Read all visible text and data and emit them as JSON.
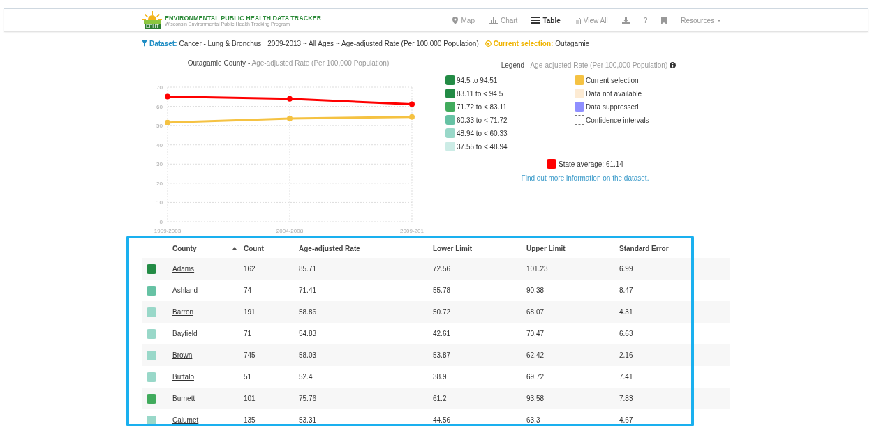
{
  "header": {
    "logo_badge": "EPHT",
    "title": "ENVIRONMENTAL PUBLIC HEALTH DATA TRACKER",
    "subtitle": "Wisconsin Environmental Public Health Tracking Program"
  },
  "nav": [
    {
      "kind": "map",
      "label": "Map",
      "selected": false
    },
    {
      "kind": "chart",
      "label": "Chart",
      "selected": false
    },
    {
      "kind": "table",
      "label": "Table",
      "selected": true
    },
    {
      "kind": "viewall",
      "label": "View All",
      "selected": false
    },
    {
      "kind": "download"
    },
    {
      "kind": "help",
      "label": "?"
    },
    {
      "kind": "bookmark"
    },
    {
      "kind": "menu",
      "label": "Resources"
    }
  ],
  "dataset_bar": {
    "label": "Dataset:",
    "dataset": "Cancer - Lung & Bronchus",
    "details": "2009-2013 ~ All Ages ~ Age-adjusted Rate (Per 100,000 Population)",
    "selection_label": "Current selection:",
    "selection": "Outagamie"
  },
  "chart": {
    "heading": "Outagamie County -",
    "subheading": "Age-adjusted Rate (Per 100,000 Population)",
    "chart_data": {
      "type": "line",
      "grid": true,
      "categories": [
        "1999-2003",
        "2004-2008",
        "2009-201"
      ],
      "ylim": [
        0,
        70
      ],
      "yticks": [
        0,
        10,
        20,
        30,
        40,
        50,
        60,
        70
      ],
      "series": [
        {
          "color": "#ff0000",
          "marker": true,
          "values": [
            65.1,
            63.9,
            61.1
          ]
        },
        {
          "color": "#f5c242",
          "marker": true,
          "values": [
            51.6,
            53.7,
            54.5
          ]
        }
      ]
    }
  },
  "legend": {
    "heading": "Legend -",
    "subheading": "Age-adjusted Rate (Per 100,000 Population)",
    "ranges": [
      {
        "label": "94.5 to 94.51",
        "color": "#238b45"
      },
      {
        "label": "83.11 to < 94.5",
        "color": "#238b45"
      },
      {
        "label": "71.72 to < 83.11",
        "color": "#41ab5d"
      },
      {
        "label": "60.33 to < 71.72",
        "color": "#66c2a4"
      },
      {
        "label": "48.94 to < 60.33",
        "color": "#99d8c9"
      },
      {
        "label": "37.55 to < 48.94",
        "color": "#ccece6"
      }
    ],
    "keys": [
      {
        "kind": "fill",
        "label": "Current selection",
        "color": "#f5c242"
      },
      {
        "kind": "fill",
        "label": "Data not available",
        "color": "#fdebd3"
      },
      {
        "kind": "fill",
        "label": "Data suppressed",
        "color": "#8f8fff"
      },
      {
        "kind": "dashed",
        "label": "Confidence intervals"
      }
    ],
    "state_average": {
      "label": "State average: 61.14",
      "color": "#ff0000"
    },
    "link": "Find out more information on the dataset."
  },
  "table": {
    "columns": [
      "County",
      "Count",
      "Age-adjusted Rate",
      "Lower Limit",
      "Upper Limit",
      "Standard Error"
    ],
    "rows": [
      {
        "color": "#238b45",
        "cells": [
          "Adams",
          "162",
          "85.71",
          "72.56",
          "101.23",
          "6.99"
        ]
      },
      {
        "color": "#66c2a4",
        "cells": [
          "Ashland",
          "74",
          "71.41",
          "55.78",
          "90.38",
          "8.47"
        ]
      },
      {
        "color": "#99d8c9",
        "cells": [
          "Barron",
          "191",
          "58.86",
          "50.72",
          "68.07",
          "4.31"
        ]
      },
      {
        "color": "#99d8c9",
        "cells": [
          "Bayfield",
          "71",
          "54.83",
          "42.61",
          "70.47",
          "6.63"
        ]
      },
      {
        "color": "#99d8c9",
        "cells": [
          "Brown",
          "745",
          "58.03",
          "53.87",
          "62.42",
          "2.16"
        ]
      },
      {
        "color": "#99d8c9",
        "cells": [
          "Buffalo",
          "51",
          "52.4",
          "38.9",
          "69.72",
          "7.41"
        ]
      },
      {
        "color": "#41ab5d",
        "cells": [
          "Burnett",
          "101",
          "75.76",
          "61.2",
          "93.58",
          "7.83"
        ]
      },
      {
        "color": "#99d8c9",
        "cells": [
          "Calumet",
          "135",
          "53.31",
          "44.56",
          "63.3",
          "4.67"
        ]
      }
    ]
  }
}
